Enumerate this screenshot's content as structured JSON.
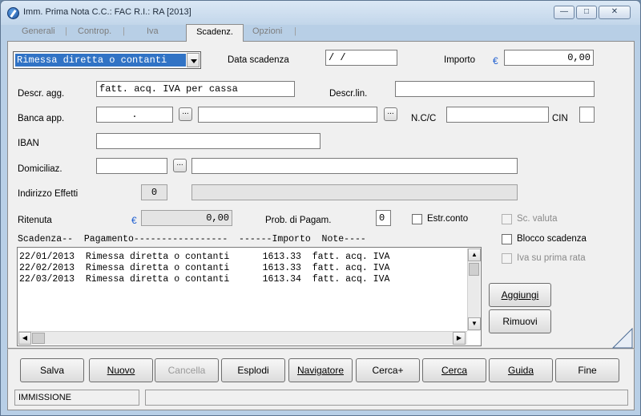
{
  "window": {
    "title": "Imm. Prima Nota C.C.: FAC  R.I.: RA  [2013]"
  },
  "tabs": [
    {
      "label": "Generali"
    },
    {
      "label": "Controp."
    },
    {
      "label": "Iva"
    },
    {
      "label": "Scadenz."
    },
    {
      "label": "Opzioni"
    }
  ],
  "form": {
    "pagamento_selected": "Rimessa diretta o contanti",
    "data_scadenza_label": "Data scadenza",
    "data_scadenza_value": "  /  /",
    "importo_label": "Importo",
    "currency_symbol": "€",
    "importo_value": "0,00",
    "descr_agg_label": "Descr. agg.",
    "descr_agg_value": "fatt. acq. IVA per cassa",
    "descr_lin_label": "Descr.lin.",
    "descr_lin_value": "",
    "banca_app_label": "Banca app.",
    "banca_code": ".",
    "banca_name": "",
    "ncc_label": "N.C/C",
    "ncc_value": "",
    "cin_label": "CIN",
    "cin_value": "",
    "iban_label": "IBAN",
    "iban_value": "",
    "domiciliaz_label": "Domiciliaz.",
    "domiciliaz_code": "",
    "domiciliaz_name": "",
    "indirizzo_effetti_label": "Indirizzo Effetti",
    "indirizzo_effetti_value": "0",
    "indirizzo_effetti_desc": "",
    "ritenuta_label": "Ritenuta",
    "ritenuta_value": "0,00",
    "prob_pagam_label": "Prob. di Pagam.",
    "prob_pagam_value": "0",
    "estr_conto_label": "Estr.conto",
    "sc_valuta_label": "Sc. valuta",
    "blocco_scadenza_label": "Blocco scadenza",
    "iva_prima_rata_label": "Iva su prima rata"
  },
  "scadenze": {
    "header": "Scadenza--  Pagamento-----------------  ------Importo  Note----",
    "rows": [
      "22/01/2013  Rimessa diretta o contanti      1613.33  fatt. acq. IVA",
      "22/02/2013  Rimessa diretta o contanti      1613.33  fatt. acq. IVA",
      "22/03/2013  Rimessa diretta o contanti      1613.34  fatt. acq. IVA"
    ],
    "aggiungi_label": "Aggiungi",
    "rimuovi_label": "Rimuovi"
  },
  "buttons": {
    "salva": "Salva",
    "nuovo": "Nuovo",
    "cancella": "Cancella",
    "esplodi": "Esplodi",
    "navigatore": "Navigatore",
    "cerca_plus": "Cerca+",
    "cerca": "Cerca",
    "guida": "Guida",
    "fine": "Fine"
  },
  "status": {
    "mode": "IMMISSIONE",
    "message": ""
  },
  "icons": {
    "app": "app-icon",
    "minimize": "minimize-icon",
    "maximize": "maximize-icon",
    "close": "close-icon",
    "dropdown": "chevron-down-icon",
    "resize_corner": "resize-corner-icon"
  }
}
